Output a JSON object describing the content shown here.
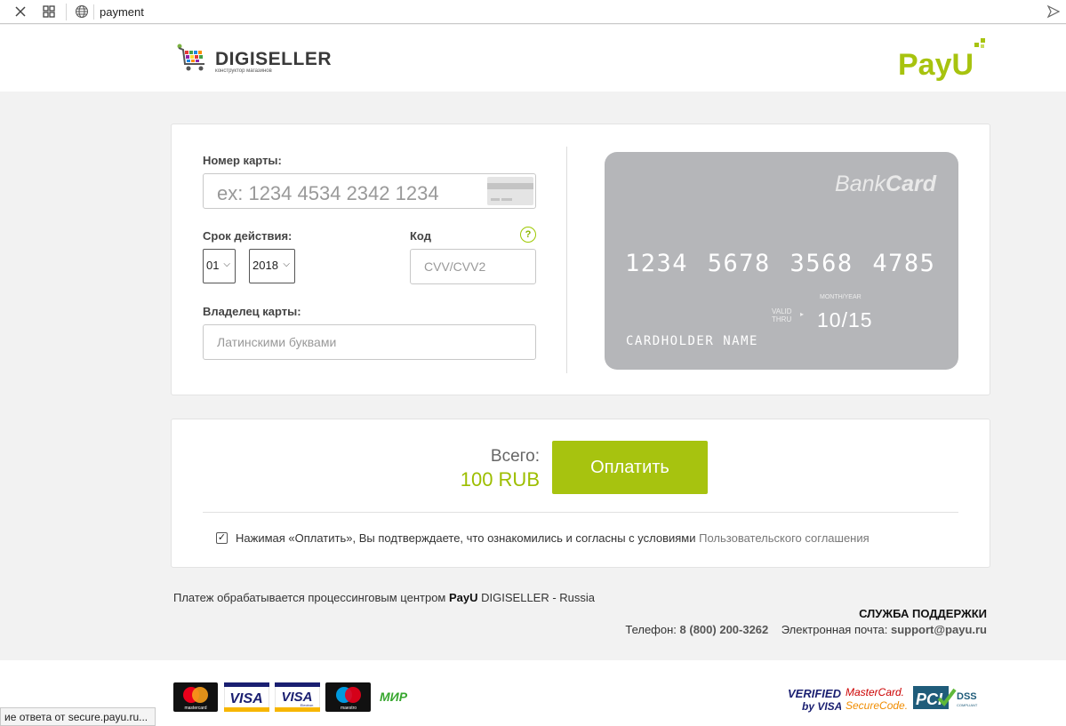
{
  "browser": {
    "url": "payment",
    "close_icon": "close-icon",
    "tabs_icon": "grid-icon",
    "site_icon": "globe-icon",
    "go_icon": "send-arrow-icon"
  },
  "header": {
    "merchant_logo": "DIGISELLER",
    "merchant_logo_sub": "конструктор магазинов",
    "processor_logo": "PayU"
  },
  "form": {
    "card_number_label": "Номер карты:",
    "card_number_placeholder": "ex: 1234 4534 2342 1234",
    "expiry_label": "Срок действия:",
    "expiry_month": "01",
    "expiry_year": "2018",
    "cvv_label": "Код",
    "cvv_help": "?",
    "cvv_placeholder": "CVV/CVV2",
    "holder_label": "Владелец карты:",
    "holder_placeholder": "Латинскими буквами"
  },
  "card_preview": {
    "brand_light": "Bank",
    "brand_bold": "Card",
    "number": "1234 5678 3568 4785",
    "month_year_label": "MONTH/YEAR",
    "valid_thru_line1": "VALID",
    "valid_thru_line2": "THRU",
    "valid_thru_arrow": "▸",
    "expiry": "10/15",
    "holder": "CARDHOLDER NAME"
  },
  "payment": {
    "total_label": "Всего:",
    "total_amount": "100 RUB",
    "pay_button": "Оплатить",
    "agree_checked": "✓",
    "agree_text": "Нажимая «Оплатить», Вы подтверждаете, что ознакомились и согласны с условиями",
    "agree_link": "Пользовательского соглашения"
  },
  "footer": {
    "processed_prefix": "Платеж обрабатывается процессинговым центром",
    "processed_brand": "PayU",
    "processed_suffix": "DIGISELLER - Russia",
    "support_title": "СЛУЖБА ПОДДЕРЖКИ",
    "phone_label": "Телефон:",
    "phone": "8 (800) 200-3262",
    "email_label": "Электронная почта:",
    "email": "support@payu.ru"
  },
  "payment_logos": {
    "mastercard": "mastercard",
    "visa": "VISA",
    "visa_electron": "VISA",
    "visa_electron_sub": "Electron",
    "maestro": "maestro",
    "mir": "МИР"
  },
  "security_logos": {
    "verified_line1": "VERIFIED",
    "verified_line2": "by VISA",
    "securecode_line1": "MasterCard.",
    "securecode_line2": "SecureCode.",
    "pci": "PCI",
    "dss": "DSS",
    "dss_sub": "COMPLIANT"
  },
  "status_bar": "ие ответа от secure.payu.ru...",
  "colors": {
    "accent_green": "#a7c30f",
    "amount_green": "#9dbe00",
    "card_gray": "#b5b6b9"
  }
}
